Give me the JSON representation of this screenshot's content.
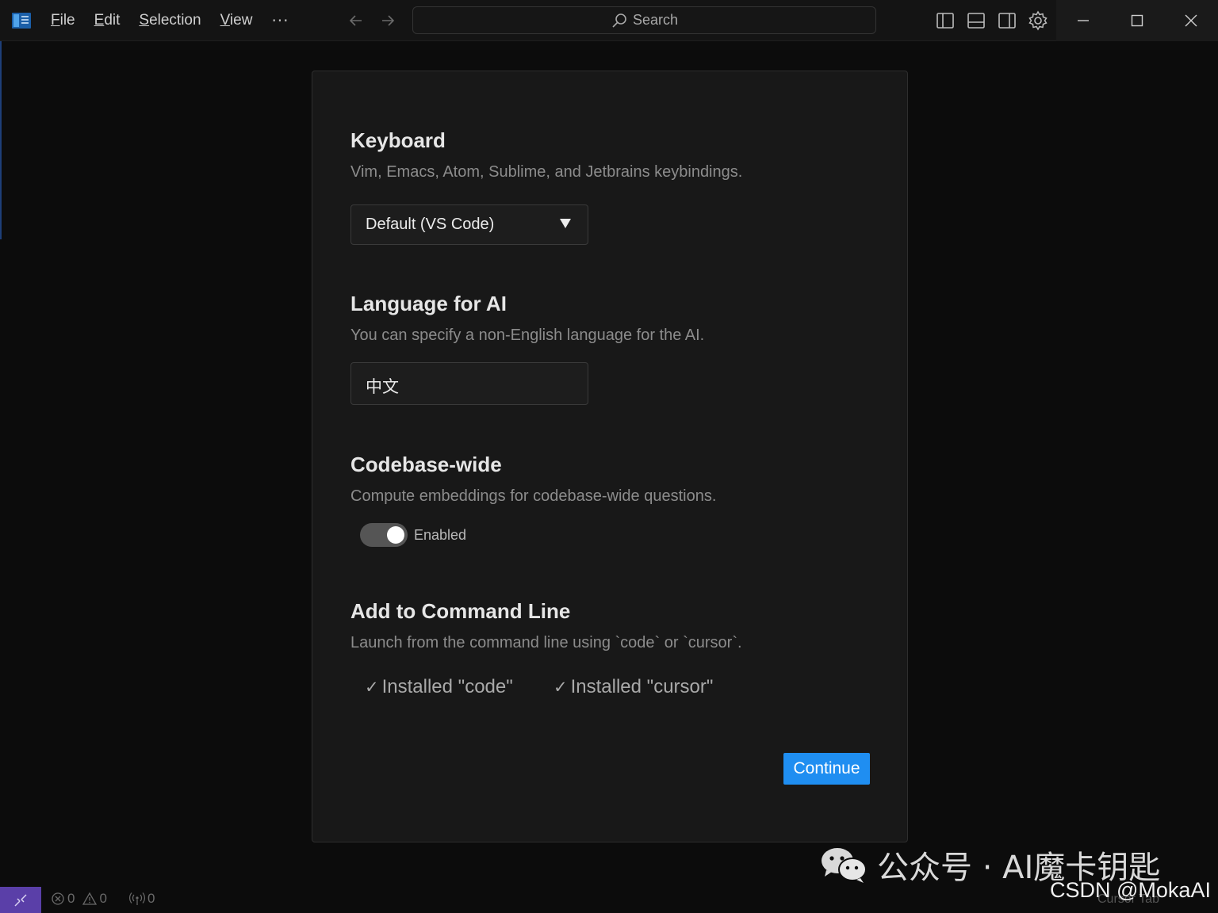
{
  "menu": {
    "items": [
      {
        "accel": "F",
        "rest": "ile"
      },
      {
        "accel": "E",
        "rest": "dit"
      },
      {
        "accel": "S",
        "rest": "election"
      },
      {
        "accel": "V",
        "rest": "iew"
      }
    ],
    "more": "···"
  },
  "search": {
    "label": "Search"
  },
  "keyboard": {
    "title": "Keyboard",
    "description": "Vim, Emacs, Atom, Sublime, and Jetbrains keybindings.",
    "selected": "Default (VS Code)"
  },
  "language": {
    "title": "Language for AI",
    "description": "You can specify a non-English language for the AI.",
    "value": "中文"
  },
  "codebase": {
    "title": "Codebase-wide",
    "description": "Compute embeddings for codebase-wide questions.",
    "toggle_label": "Enabled",
    "enabled": true
  },
  "command_line": {
    "title": "Add to Command Line",
    "description": "Launch from the command line using `code` or `cursor`.",
    "check": "✓",
    "installed_code": "Installed \"code\"",
    "installed_cursor": "Installed \"cursor\""
  },
  "continue_label": "Continue",
  "status": {
    "errors": "0",
    "warnings": "0",
    "ports": "0",
    "right_text": "Cursor Tab"
  },
  "watermark": {
    "wechat": "公众号 · AI魔卡钥匙",
    "csdn": "CSDN @MokaAI"
  },
  "colors": {
    "accent": "#1f8ef1",
    "remote": "#5a3fa8"
  }
}
